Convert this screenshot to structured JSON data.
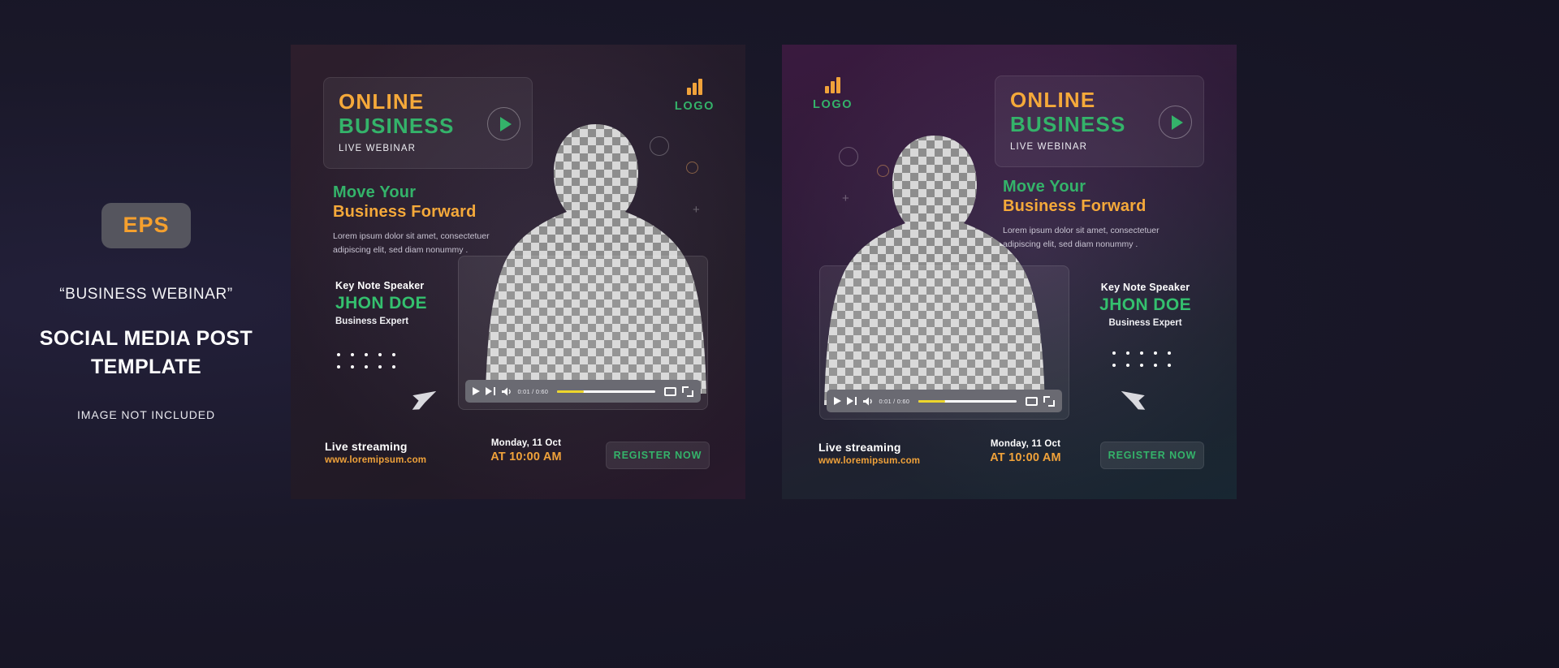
{
  "left_panel": {
    "badge": "EPS",
    "quote": "“BUSINESS WEBINAR”",
    "title_line1": "SOCIAL MEDIA POST",
    "title_line2": "TEMPLATE",
    "note": "IMAGE NOT INCLUDED"
  },
  "poster": {
    "headline": {
      "line1": "ONLINE",
      "line2": "BUSINESS",
      "sub": "LIVE WEBINAR"
    },
    "logo": {
      "text": "LOGO"
    },
    "tagline": {
      "green": "Move Your",
      "orange": "Business Forward",
      "body_line1": "Lorem ipsum dolor sit amet, consectetuer",
      "body_line2": "adipiscing elit, sed diam nonummy ."
    },
    "speaker": {
      "role": "Key Note Speaker",
      "name": "JHON DOE",
      "title": "Business Expert"
    },
    "player": {
      "time": "0:01 / 0:60",
      "progress_percent": 27
    },
    "footer": {
      "live_title": "Live streaming",
      "live_url": "www.loremipsum.com",
      "date": "Monday,  11 Oct",
      "time": "AT 10:00 AM",
      "cta": "REGISTER NOW"
    }
  },
  "colors": {
    "orange": "#f5a93a",
    "green": "#34b36a",
    "yellow_seek": "#edd62b",
    "poster_a_bg": "#2e2336",
    "poster_b_bg": "#3a2347",
    "page_bg": "#171726"
  }
}
